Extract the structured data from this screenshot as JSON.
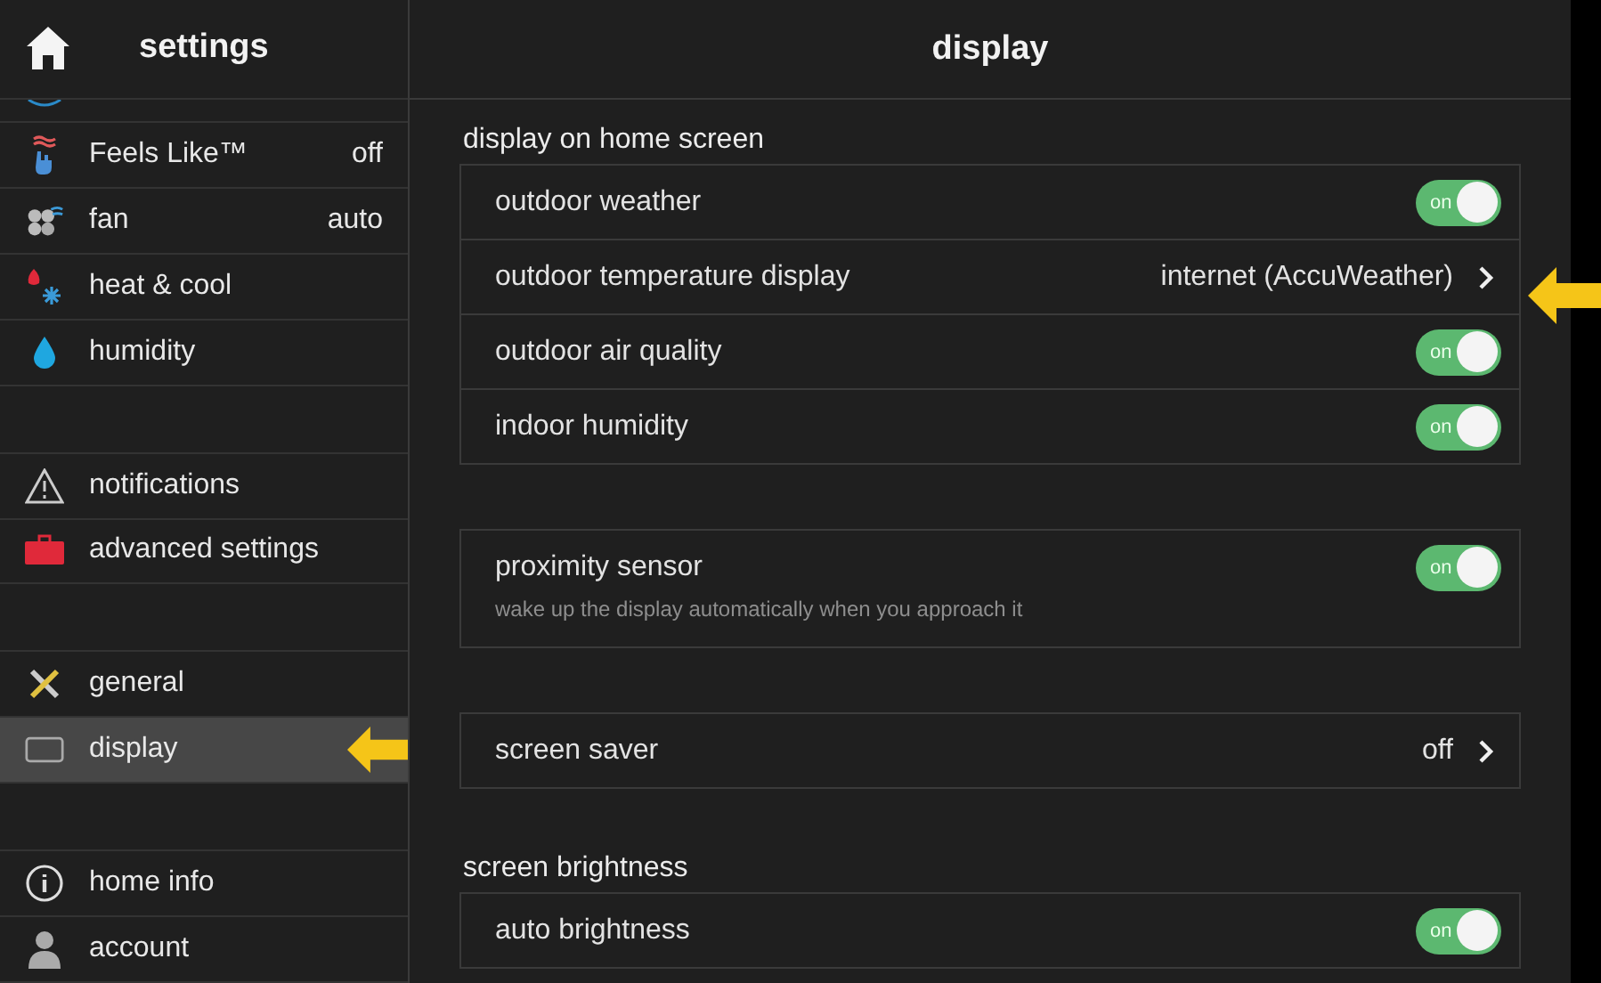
{
  "sidebar": {
    "title": "settings",
    "groups": [
      [
        {
          "label": "Feels Like™",
          "value": "off",
          "selected": false
        },
        {
          "label": "fan",
          "value": "auto",
          "selected": false
        },
        {
          "label": "heat & cool",
          "selected": false
        },
        {
          "label": "humidity",
          "selected": false
        }
      ],
      [
        {
          "label": "notifications",
          "selected": false
        },
        {
          "label": "advanced settings",
          "selected": false
        }
      ],
      [
        {
          "label": "general",
          "selected": false
        },
        {
          "label": "display",
          "selected": true
        }
      ],
      [
        {
          "label": "home info",
          "selected": false
        },
        {
          "label": "account",
          "selected": false
        }
      ]
    ]
  },
  "main": {
    "title": "display",
    "sections": [
      {
        "title": "display on home screen",
        "rows": [
          {
            "kind": "toggle",
            "label": "outdoor weather",
            "on": true,
            "text": "on"
          },
          {
            "kind": "link",
            "label": "outdoor temperature display",
            "value": "internet (AccuWeather)"
          },
          {
            "kind": "toggle",
            "label": "outdoor air quality",
            "on": true,
            "text": "on"
          },
          {
            "kind": "toggle",
            "label": "indoor humidity",
            "on": true,
            "text": "on"
          }
        ]
      },
      {
        "rows": [
          {
            "kind": "toggle",
            "label": "proximity sensor",
            "on": true,
            "text": "on",
            "note": "wake up the display automatically when you approach it"
          }
        ]
      },
      {
        "rows": [
          {
            "kind": "link",
            "label": "screen saver",
            "value": "off"
          }
        ]
      },
      {
        "title": "screen brightness",
        "rows": [
          {
            "kind": "toggle",
            "label": "auto brightness",
            "on": true,
            "text": "on"
          }
        ]
      }
    ]
  }
}
